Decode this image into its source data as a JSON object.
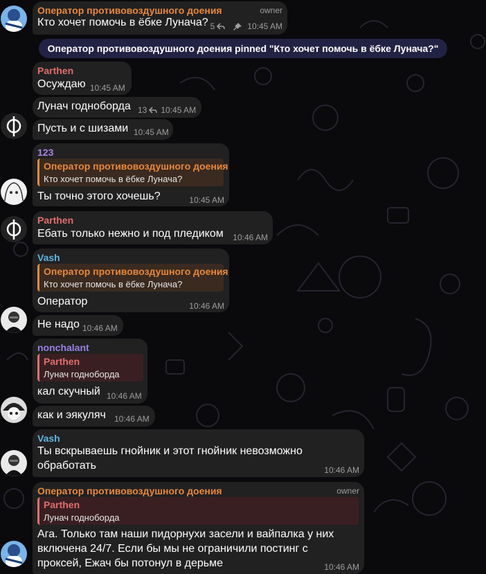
{
  "chat": {
    "pinned_notice": "Оператор противовоздушного доения pinned \"Кто хочет помочь в ёбке Лунача?\"",
    "messages": [
      {
        "sender": "Оператор противовоздушного доения",
        "role": "owner",
        "text": "Кто хочет помочь в ёбке Лунача?",
        "replies": "5",
        "time": "10:45 AM"
      },
      {
        "sender": "Parthen",
        "text": "Осуждаю",
        "time": "10:45 AM"
      },
      {
        "text": "Лунач годнoборда",
        "replies": "13",
        "time": "10:45 AM"
      },
      {
        "text": "Пусть и с шизами",
        "time": "10:45 AM"
      },
      {
        "sender": "123",
        "reply": {
          "name": "Оператор противовоздушного доения",
          "text": "Кто хочет помочь в ёбке Лунача?"
        },
        "text": "Ты точно этого хочешь?",
        "time": "10:45 AM"
      },
      {
        "sender": "Parthen",
        "text": "Ебать только нежно и под пледиком",
        "time": "10:46 AM"
      },
      {
        "sender": "Vash",
        "reply": {
          "name": "Оператор противовоздушного доения",
          "text": "Кто хочет помочь в ёбке Лунача?"
        },
        "text": "Оператор",
        "time": "10:46 AM"
      },
      {
        "text": "Не надо",
        "time": "10:46 AM"
      },
      {
        "sender": "nonchalant",
        "reply": {
          "name": "Parthen",
          "text": "Лунач годнoборда"
        },
        "text": "кал скучный",
        "time": "10:46 AM"
      },
      {
        "text": "как и эякуляч",
        "time": "10:46 AM"
      },
      {
        "sender": "Vash",
        "text_lines": [
          "Ты вскрываешь гнойник и этот гнойник невозможно",
          "обработать"
        ],
        "time": "10:46 AM"
      },
      {
        "sender": "Оператор противовоздушного доения",
        "role": "owner",
        "reply": {
          "name": "Parthen",
          "text": "Лунач годнoборда"
        },
        "text_lines": [
          "Ага. Только там наши пидорнухи засели и вайпалка у них",
          "включена 24/7. Если бы мы не ограничили постинг с",
          "проксей, Ежач бы потонул в дерьме"
        ],
        "time": "10:46 AM"
      }
    ]
  },
  "colors": {
    "bubble": "#212121",
    "operator_name": "#e8893b",
    "parthen_name": "#e06e6e",
    "user123_name": "#a884e8",
    "vash_name": "#5fb6df",
    "nonchalant_name": "#9b80e4",
    "pinned_bg": "#222244",
    "meta": "#9e9e9e"
  },
  "icons": [
    "reply-arrow-icon",
    "pin-icon",
    "phi-avatar-icon"
  ]
}
